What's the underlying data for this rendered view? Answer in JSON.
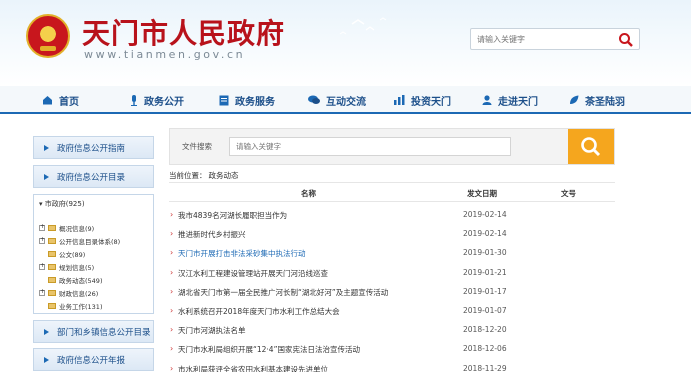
{
  "header": {
    "site_title": "天门市人民政府",
    "site_url": "www.tianmen.gov.cn",
    "search_placeholder": "请输入关键字"
  },
  "nav": [
    {
      "label": "首页",
      "icon": "home-icon"
    },
    {
      "label": "政务公开",
      "icon": "microphone-icon"
    },
    {
      "label": "政务服务",
      "icon": "document-icon"
    },
    {
      "label": "互动交流",
      "icon": "chat-icon"
    },
    {
      "label": "投资天门",
      "icon": "chart-icon"
    },
    {
      "label": "走进天门",
      "icon": "user-icon"
    },
    {
      "label": "茶圣陆羽",
      "icon": "leaf-icon"
    }
  ],
  "left": {
    "buttons_top": [
      "政府信息公开指南",
      "政府信息公开目录"
    ],
    "tree_root": "市政府(925)",
    "tree": [
      {
        "label": "概况信息(9)",
        "expandable": true
      },
      {
        "label": "公开信息目录体系(8)",
        "expandable": true
      },
      {
        "label": "公文(89)",
        "expandable": false
      },
      {
        "label": "规划信息(5)",
        "expandable": true
      },
      {
        "label": "政务动态(549)",
        "expandable": false
      },
      {
        "label": "财政信息(26)",
        "expandable": true
      },
      {
        "label": "业务工作(131)",
        "expandable": false
      }
    ],
    "buttons_bottom": [
      "部门和乡镇信息公开目录",
      "政府信息公开年报"
    ]
  },
  "search": {
    "label": "文件搜索",
    "placeholder": "请输入关键字"
  },
  "breadcrumb": {
    "prefix": "当前位置：",
    "current": "政务动态"
  },
  "table": {
    "headers": {
      "title": "名称",
      "date": "发文日期",
      "number": "文号"
    },
    "rows": [
      {
        "title": "我市4839名河湖长履职担当作为",
        "date": "2019-02-14",
        "number": "",
        "highlight": false
      },
      {
        "title": "推进新时代乡村振兴",
        "date": "2019-02-14",
        "number": "",
        "highlight": false
      },
      {
        "title": "天门市开展打击非法采砂集中执法行动",
        "date": "2019-01-30",
        "number": "",
        "highlight": true
      },
      {
        "title": "汉江水利工程建设管理站开展天门河沿线巡查",
        "date": "2019-01-21",
        "number": "",
        "highlight": false
      },
      {
        "title": "湖北省天门市第一届全民推广河长制“湖北好河”及主题宣传活动",
        "date": "2019-01-17",
        "number": "",
        "highlight": false
      },
      {
        "title": "水利系统召开2018年度天门市水利工作总结大会",
        "date": "2019-01-07",
        "number": "",
        "highlight": false
      },
      {
        "title": "天门市河湖执法名单",
        "date": "2018-12-20",
        "number": "",
        "highlight": false
      },
      {
        "title": "天门市水利局组织开展“12·4”国家宪法日法治宣传活动",
        "date": "2018-12-06",
        "number": "",
        "highlight": false
      },
      {
        "title": "市水利局获评全省农田水利基本建设先进单位",
        "date": "2018-11-29",
        "number": "",
        "highlight": false
      }
    ]
  },
  "colors": {
    "brand_red": "#b8121b",
    "nav_blue": "#1c4f8a",
    "accent_orange": "#f5a61e"
  }
}
